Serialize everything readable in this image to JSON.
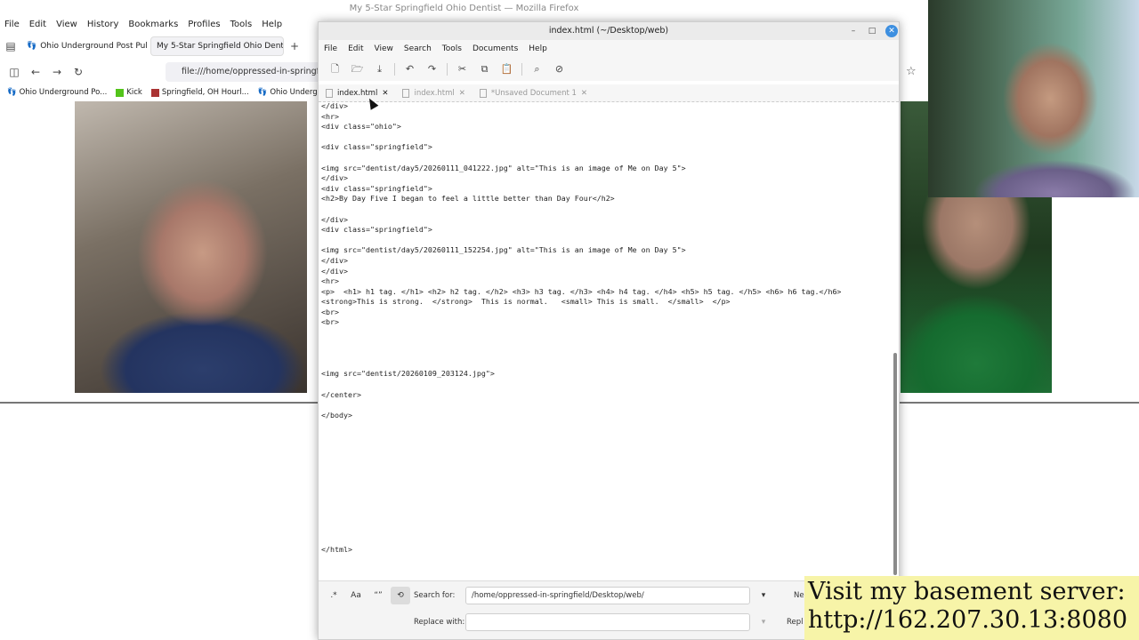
{
  "firefox": {
    "window_title": "My 5-Star Springfield Ohio Dentist — Mozilla Firefox",
    "menu": [
      "File",
      "Edit",
      "View",
      "History",
      "Bookmarks",
      "Profiles",
      "Tools",
      "Help"
    ],
    "tabs": [
      {
        "label": "Ohio Underground Post Pul"
      },
      {
        "label": "My 5-Star Springfield Ohio Dent"
      }
    ],
    "url": "file:///home/oppressed-in-springfie",
    "bookmarks": [
      {
        "label": "Ohio Underground Po..."
      },
      {
        "label": "Kick"
      },
      {
        "label": "Springfield, OH Hourl..."
      },
      {
        "label": "Ohio Undergr"
      }
    ]
  },
  "gedit": {
    "window_title": "index.html (~/Desktop/web)",
    "menu": [
      "File",
      "Edit",
      "View",
      "Search",
      "Tools",
      "Documents",
      "Help"
    ],
    "tabs": [
      {
        "label": "index.html",
        "active": true
      },
      {
        "label": "index.html",
        "active": false
      },
      {
        "label": "*Unsaved Document 1",
        "active": false
      }
    ],
    "code": "</div>\n<hr>\n<div class=\"ohio\">\n\n<div class=\"springfield\">\n\n<img src=\"dentist/day5/20260111_041222.jpg\" alt=\"This is an image of Me on Day 5\">\n</div>\n<div class=\"springfield\">\n<h2>By Day Five I began to feel a little better than Day Four</h2>\n\n</div>\n<div class=\"springfield\">\n\n<img src=\"dentist/day5/20260111_152254.jpg\" alt=\"This is an image of Me on Day 5\">\n</div>\n</div>\n<hr>\n<p>  <h1> h1 tag. </h1> <h2> h2 tag. </h2> <h3> h3 tag. </h3> <h4> h4 tag. </h4> <h5> h5 tag. </h5> <h6> h6 tag.</h6>\n<strong>This is strong.  </strong>  This is normal.   <small> This is small.  </small>  </p>\n<br>\n<br>\n\n\n\n\n<img src=\"dentist/20260109_203124.jpg\">\n\n</center>\n\n</body>\n\n\n\n\n\n\n\n\n\n\n\n\n</html>",
    "find": {
      "search_label": "Search for:",
      "search_value": "/home/oppressed-in-springfield/Desktop/web/",
      "replace_label": "Replace with:",
      "replace_value": "",
      "next_label": "Ne",
      "replace_btn_label": "Repl"
    }
  },
  "banner": {
    "line1": "Visit my basement server:",
    "line2": "http://162.207.30.13:8080"
  }
}
